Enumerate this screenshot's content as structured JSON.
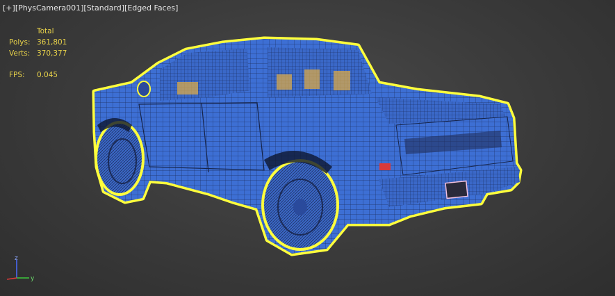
{
  "viewport": {
    "labels": [
      "[+]",
      "[PhysCamera001]",
      "[Standard]",
      "[Edged Faces]"
    ]
  },
  "stats": {
    "header": "Total",
    "polys_label": "Polys:",
    "polys_value": "361,801",
    "verts_label": "Verts:",
    "verts_value": "370,377",
    "fps_label": "FPS:",
    "fps_value": "0.045"
  },
  "gizmo": {
    "z": "z",
    "y": "y"
  },
  "colors": {
    "mesh_fill": "#3d6fd4",
    "wire": "#1b2c55",
    "selection_outline": "#ffff3c",
    "stats_text": "#e8d24a"
  }
}
